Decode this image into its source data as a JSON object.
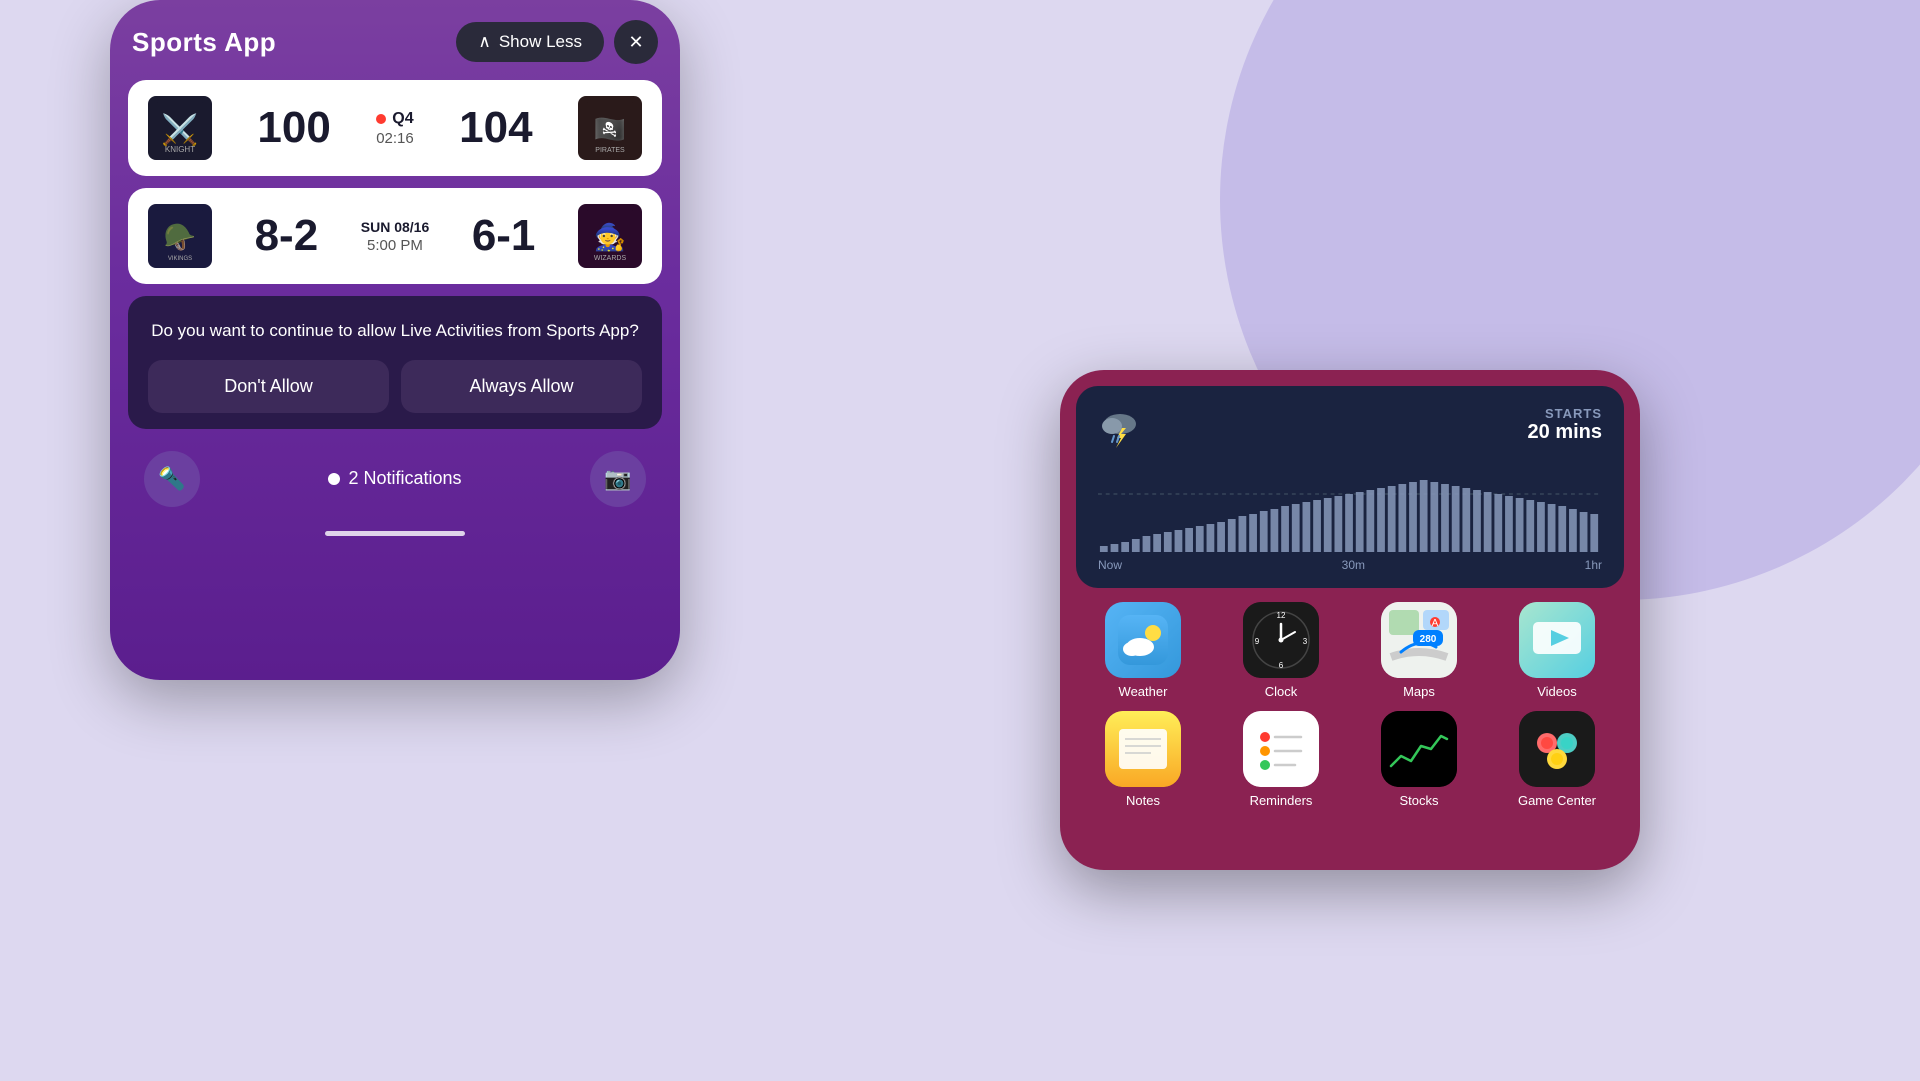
{
  "background": {
    "color": "#ddd8f0"
  },
  "left_phone": {
    "title": "Sports App",
    "show_less_btn": "Show Less",
    "close_btn": "×",
    "game1": {
      "team1_name": "Knight",
      "team1_score": "100",
      "team1_emoji": "⚔️",
      "period": "Q4",
      "time": "02:16",
      "team2_score": "104",
      "team2_name": "Pirates",
      "team2_emoji": "🏴‍☠️",
      "is_live": true
    },
    "game2": {
      "team1_name": "Vikings",
      "team1_score": "8-2",
      "team1_emoji": "🪖",
      "date": "SUN 08/16",
      "time": "5:00 PM",
      "team2_score": "6-1",
      "team2_name": "Wizards",
      "team2_emoji": "🧙",
      "is_live": false
    },
    "notification": {
      "message": "Do you want to continue to allow Live Activities from Sports App?",
      "dont_allow": "Don't Allow",
      "always_allow": "Always Allow"
    },
    "bottom_bar": {
      "notifications_count": "2 Notifications",
      "flashlight_icon": "🔦",
      "camera_icon": "📷"
    }
  },
  "right_phone": {
    "weather_widget": {
      "icon": "⛈️",
      "starts_label": "STARTS",
      "starts_time": "20 mins",
      "chart_labels": [
        "Now",
        "30m",
        "1hr"
      ]
    },
    "apps": [
      {
        "name": "Weather",
        "type": "weather"
      },
      {
        "name": "Clock",
        "type": "clock"
      },
      {
        "name": "Maps",
        "type": "maps"
      },
      {
        "name": "Videos",
        "type": "videos"
      },
      {
        "name": "Notes",
        "type": "notes"
      },
      {
        "name": "Reminders",
        "type": "reminders"
      },
      {
        "name": "Stocks",
        "type": "stocks"
      },
      {
        "name": "Game Center",
        "type": "game-center"
      }
    ]
  }
}
